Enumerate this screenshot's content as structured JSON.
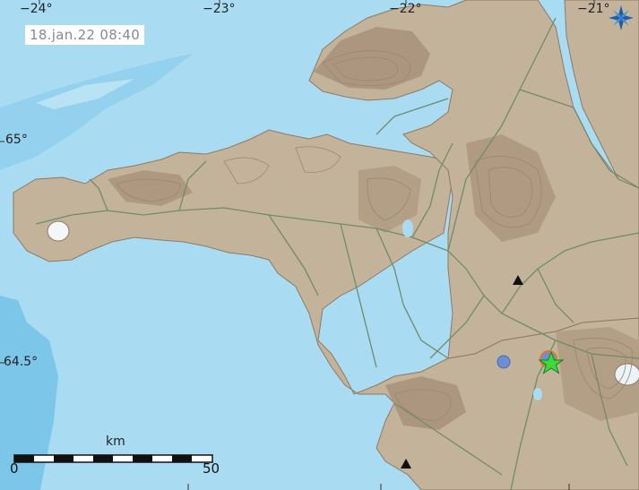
{
  "map": {
    "timestamp": "18.jan.22  08:40",
    "longitude_labels": [
      "−24°",
      "−23°",
      "−22°",
      "−21°"
    ],
    "latitude_labels": [
      "65°",
      "64.5°"
    ],
    "scale": {
      "title": "km",
      "min": "0",
      "max": "50"
    },
    "colors": {
      "sea_light": "#a9dcf2",
      "sea_deep": "#7cc6ea",
      "land": "#c4b39b",
      "land_high": "#a8917a",
      "roads": "#6f8c6a",
      "ice": "#f4f7f8",
      "quake_star": "#3adb3a",
      "quake_dot": "#6b8fd1",
      "volcano": "#111111",
      "logo": "#1f5fa8"
    },
    "markers": [
      "earthquake-star",
      "earthquake-dot",
      "earthquake-dot",
      "peak-triangle",
      "peak-triangle"
    ],
    "icons": [
      "compass-logo-icon"
    ]
  }
}
